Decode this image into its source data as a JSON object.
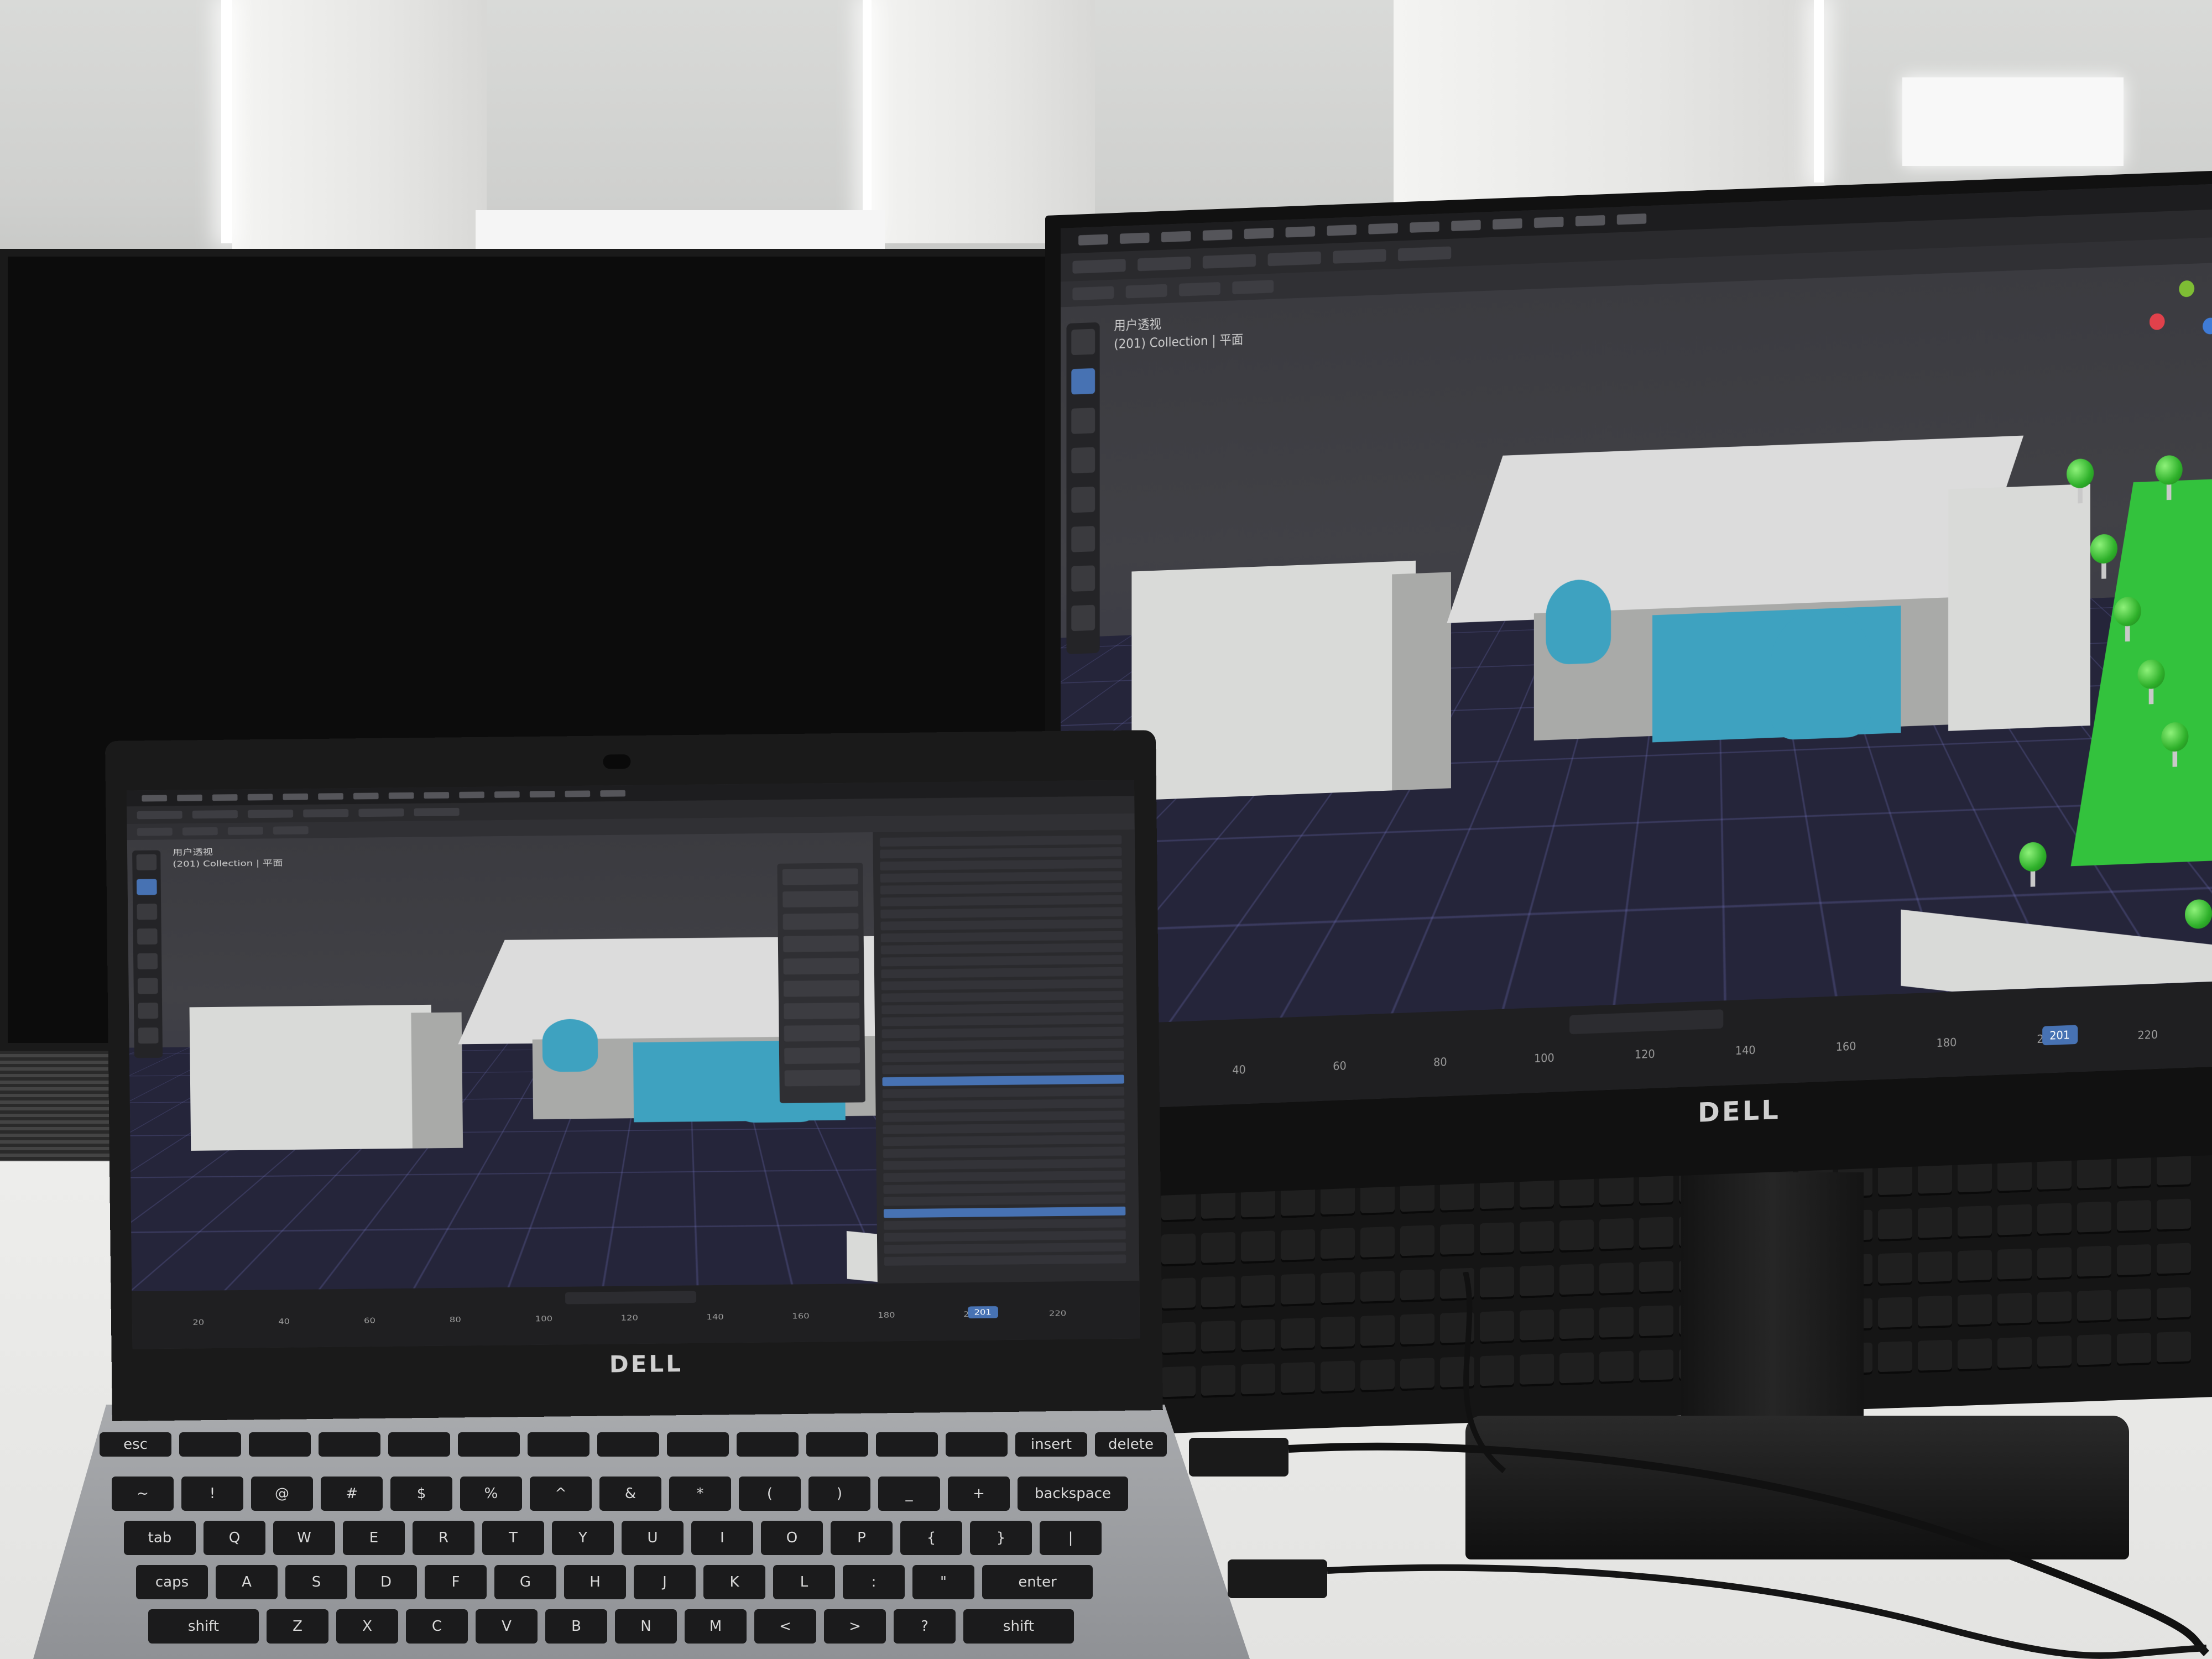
{
  "scene": {
    "devices": {
      "right_monitor_brand": "DELL",
      "laptop_brand": "DELL"
    },
    "colors": {
      "wall": "#d4d5d3",
      "desk": "#e8e8e6",
      "monitor_bezel": "#111111",
      "laptop_shell": "#9a9c9f",
      "blender_bg": "#3a3a3e",
      "blender_accent": "#4772b3",
      "building": "#d9dad8",
      "teal": "#3ea2c0",
      "field": "#33c23d"
    }
  },
  "blender": {
    "viewport_label": "用户透视",
    "collection_label": "(201) Collection | 平面",
    "current_frame": "201",
    "timeline_frames": [
      "20",
      "40",
      "60",
      "80",
      "100",
      "120",
      "140",
      "160",
      "180",
      "200",
      "220"
    ],
    "sign_text": "",
    "icons": [
      "cursor-icon",
      "move-icon",
      "rotate-icon",
      "scale-icon",
      "transform-icon",
      "annotate-icon",
      "measure-icon",
      "add-cube-icon"
    ]
  },
  "laptop_keyboard": {
    "row_function": [
      "esc",
      "",
      "",
      "",
      "",
      "",
      "",
      "",
      "",
      "",
      "",
      "",
      "",
      "insert",
      "delete"
    ],
    "row_numbers": [
      "~",
      "!",
      "@",
      "#",
      "$",
      "%",
      "^",
      "&",
      "*",
      "(",
      ")",
      "_",
      "+",
      "backspace"
    ],
    "row_top": [
      "tab",
      "Q",
      "W",
      "E",
      "R",
      "T",
      "Y",
      "U",
      "I",
      "O",
      "P",
      "{",
      "}",
      "|"
    ],
    "row_home": [
      "caps",
      "A",
      "S",
      "D",
      "F",
      "G",
      "H",
      "J",
      "K",
      "L",
      ":",
      "\"",
      "enter"
    ],
    "row_bottom": [
      "shift",
      "Z",
      "X",
      "C",
      "V",
      "B",
      "N",
      "M",
      "<",
      ">",
      "?",
      "shift"
    ]
  }
}
